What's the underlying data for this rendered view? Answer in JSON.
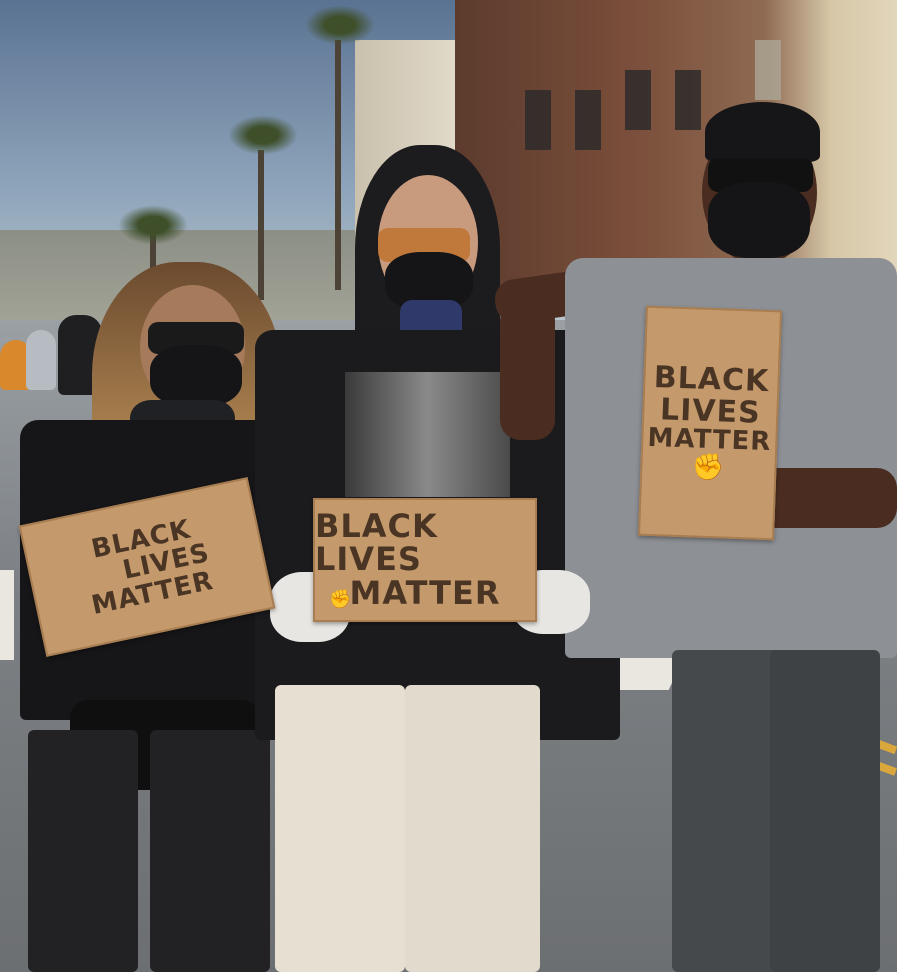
{
  "scene": {
    "colors": {
      "cardboard": "#c49a6c",
      "marker": "#4a3524",
      "sky": "#8fa5bb",
      "asphalt": "#7d8185"
    },
    "icons": [
      "raised-fist-icon"
    ]
  },
  "signs": {
    "left": {
      "line1": "BLACK",
      "line2": "LIVES",
      "line3": "MATTER"
    },
    "center": {
      "line1": "BLACK LIVES",
      "line2": "MATTER",
      "fist_glyph": "✊"
    },
    "right": {
      "line1": "BLACK",
      "line2": "LIVES",
      "line3": "MATTER",
      "fist_glyph": "✊"
    }
  }
}
